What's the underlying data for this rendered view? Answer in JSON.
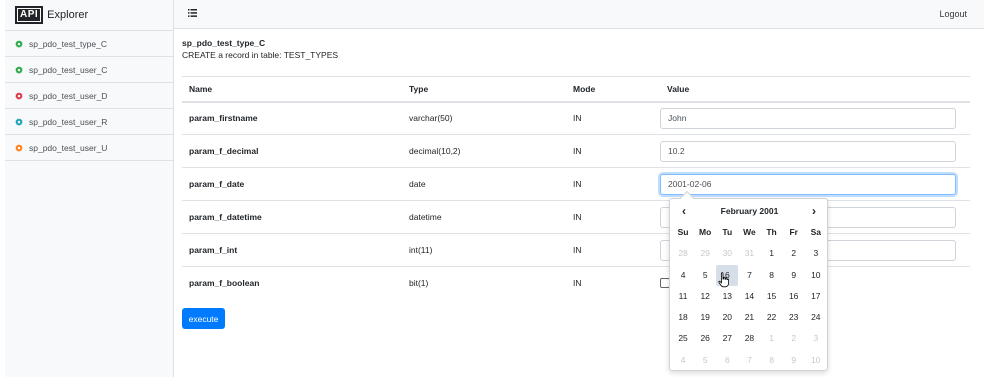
{
  "brand": {
    "badge": "API",
    "text": "Explorer"
  },
  "sidebar": {
    "items": [
      {
        "label": "sp_pdo_test_type_C",
        "color": "#28a745"
      },
      {
        "label": "sp_pdo_test_user_C",
        "color": "#28a745"
      },
      {
        "label": "sp_pdo_test_user_D",
        "color": "#dc3545"
      },
      {
        "label": "sp_pdo_test_user_R",
        "color": "#17a2b8"
      },
      {
        "label": "sp_pdo_test_user_U",
        "color": "#fd7e14"
      }
    ]
  },
  "topbar": {
    "logout": "Logout"
  },
  "procedure": {
    "name": "sp_pdo_test_type_C",
    "description": "CREATE a record in table: TEST_TYPES"
  },
  "table": {
    "headers": [
      "Name",
      "Type",
      "Mode",
      "Value"
    ],
    "rows": [
      {
        "name": "param_firstname",
        "type": "varchar(50)",
        "mode": "IN",
        "value": "John"
      },
      {
        "name": "param_f_decimal",
        "type": "decimal(10,2)",
        "mode": "IN",
        "value": "10.2"
      },
      {
        "name": "param_f_date",
        "type": "date",
        "mode": "IN",
        "value": "2001-02-06"
      },
      {
        "name": "param_f_datetime",
        "type": "datetime",
        "mode": "IN",
        "value": ""
      },
      {
        "name": "param_f_int",
        "type": "int(11)",
        "mode": "IN",
        "value": ""
      },
      {
        "name": "param_f_boolean",
        "type": "bit(1)",
        "mode": "IN",
        "value": ""
      }
    ]
  },
  "execute_label": "execute",
  "datepicker": {
    "prev": "‹",
    "next": "›",
    "title": "February 2001",
    "days_of_week": [
      "Su",
      "Mo",
      "Tu",
      "We",
      "Th",
      "Fr",
      "Sa"
    ],
    "selected": "6",
    "weeks": [
      [
        {
          "d": "28",
          "m": true
        },
        {
          "d": "29",
          "m": true
        },
        {
          "d": "30",
          "m": true
        },
        {
          "d": "31",
          "m": true
        },
        {
          "d": "1"
        },
        {
          "d": "2"
        },
        {
          "d": "3"
        }
      ],
      [
        {
          "d": "4"
        },
        {
          "d": "5"
        },
        {
          "d": "6",
          "sel": true
        },
        {
          "d": "7"
        },
        {
          "d": "8"
        },
        {
          "d": "9"
        },
        {
          "d": "10"
        }
      ],
      [
        {
          "d": "11"
        },
        {
          "d": "12"
        },
        {
          "d": "13"
        },
        {
          "d": "14"
        },
        {
          "d": "15"
        },
        {
          "d": "16"
        },
        {
          "d": "17"
        }
      ],
      [
        {
          "d": "18"
        },
        {
          "d": "19"
        },
        {
          "d": "20"
        },
        {
          "d": "21"
        },
        {
          "d": "22"
        },
        {
          "d": "23"
        },
        {
          "d": "24"
        }
      ],
      [
        {
          "d": "25"
        },
        {
          "d": "26"
        },
        {
          "d": "27"
        },
        {
          "d": "28"
        },
        {
          "d": "1",
          "m": true
        },
        {
          "d": "2",
          "m": true
        },
        {
          "d": "3",
          "m": true
        }
      ],
      [
        {
          "d": "4",
          "m": true
        },
        {
          "d": "5",
          "m": true
        },
        {
          "d": "6",
          "m": true
        },
        {
          "d": "7",
          "m": true
        },
        {
          "d": "8",
          "m": true
        },
        {
          "d": "9",
          "m": true
        },
        {
          "d": "10",
          "m": true
        }
      ]
    ]
  }
}
